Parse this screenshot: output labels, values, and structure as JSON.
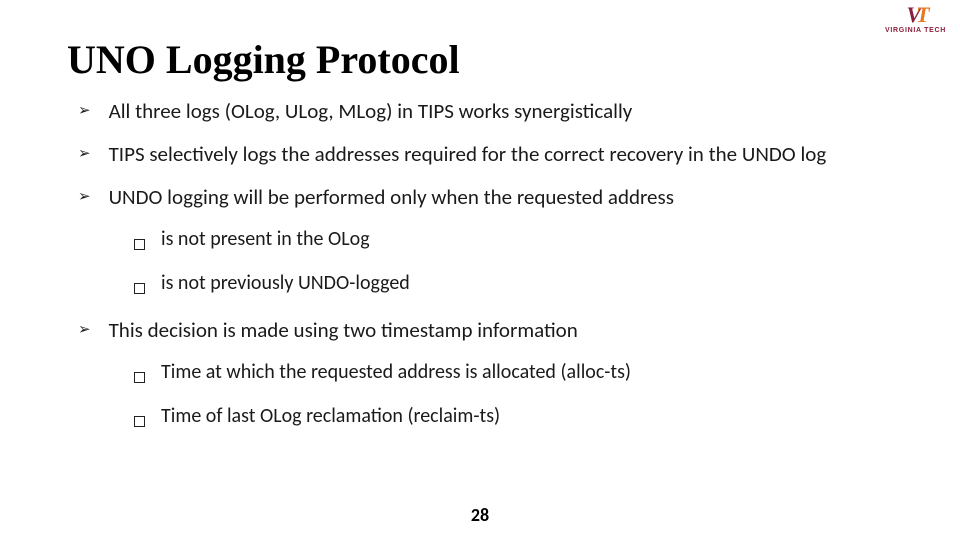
{
  "logo": {
    "mark_left": "V",
    "mark_slash": "T",
    "mark_right": "",
    "subtext": "VIRGINIA TECH"
  },
  "title": "UNO Logging Protocol",
  "bullets": [
    {
      "text": "All three logs (OLog, ULog, MLog) in TIPS works synergistically",
      "sub": []
    },
    {
      "text": "TIPS selectively logs the addresses required for the correct recovery in the UNDO log",
      "sub": []
    },
    {
      "text": "UNDO logging will be performed only when the requested address",
      "sub": [
        "is not present in the OLog",
        "is not previously UNDO-logged"
      ]
    },
    {
      "text": "This decision is made using two timestamp information",
      "sub": [
        "Time at which the requested address is allocated (alloc-ts)",
        "Time of last OLog reclamation (reclaim-ts)"
      ]
    }
  ],
  "page_number": "28"
}
